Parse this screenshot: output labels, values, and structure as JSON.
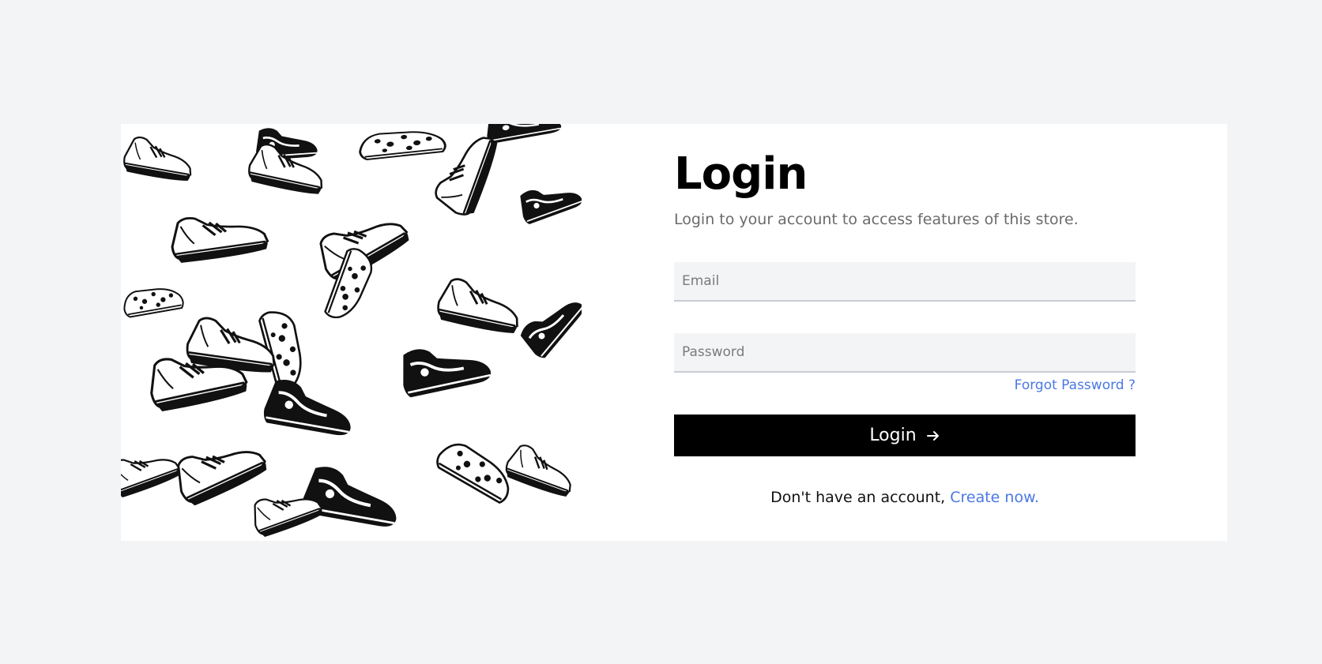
{
  "login": {
    "title": "Login",
    "subtitle": "Login to your account to access features of this store.",
    "email_placeholder": "Email",
    "password_placeholder": "Password",
    "forgot_label": "Forgot Password ?",
    "button_label": "Login",
    "button_icon": "arrow-right-icon",
    "signup_prefix": "Don't have an account, ",
    "signup_link": "Create now."
  },
  "illustration": {
    "icon": "sneakers-pattern-image"
  },
  "colors": {
    "background": "#f3f4f6",
    "card": "#ffffff",
    "accent_link": "#4a78e4",
    "button": "#000000"
  }
}
